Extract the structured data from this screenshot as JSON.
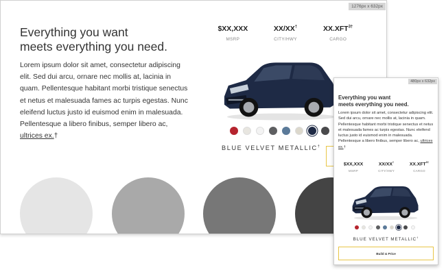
{
  "desktop": {
    "dim_badge": "1276px x 632px",
    "headline_line1": "Everything you want",
    "headline_line2": "meets everything you need.",
    "body": "Lorem ipsum dolor sit amet, consectetur adipiscing elit. Sed dui arcu, ornare nec mollis at, lacinia in quam. Pellentesque habitant morbi tristique senectus et netus et malesuada fames ac turpis egestas. Nunc eleifend luctus justo id euismod enim in malesuada. Pellentesque a libero finibus, semper libero ac, ",
    "body_link": "ultrices ex.",
    "body_mark": "†",
    "specs": [
      {
        "value": "$XX,XXX",
        "sup": "",
        "label": "MSRP"
      },
      {
        "value": "XX/XX",
        "sup": "†",
        "label": "CITY/HWY"
      },
      {
        "value": "XX.XFT",
        "sup": "3†",
        "label": "CARGO"
      }
    ],
    "color_name": "BLUE VELVET METALLIC",
    "color_mark": "†"
  },
  "mobile": {
    "dim_badge": "480px x 632px",
    "headline_line1": "Everything you want",
    "headline_line2": "meets everything you need.",
    "body": "Lorem ipsum dolor sit amet, consectetur adipiscing elit. Sed dui arcu, ornare nec mollis at, lacinia in quam. Pellentesque habitant morbi tristique senectus et netus et malesuada fames ac turpis egestas. Nunc eleifend luctus justo id euismod enim in malesuada. Pellentesque a libero finibus, semper libero ac, ",
    "body_link": "ultrices ex.",
    "body_mark": "†",
    "specs": [
      {
        "value": "$XX,XXX",
        "sup": "",
        "label": "MSRP"
      },
      {
        "value": "XX/XX",
        "sup": "†",
        "label": "CITY/HWY"
      },
      {
        "value": "XX.XFT",
        "sup": "3†",
        "label": "CARGO"
      }
    ],
    "color_name": "BLUE VELVET METALLIC",
    "color_mark": "†",
    "cta_label": "Build & Price"
  },
  "swatch_colors": [
    "#b5242e",
    "#e8e6e0",
    "#f3f3f3",
    "#5e5f61",
    "#5b7a99",
    "#dcd8cc",
    "#1e2a45",
    "#4a4a4c",
    "#f6f6f6"
  ],
  "selected_swatch": 6,
  "colors": {
    "accent_border": "#e8c545",
    "car_body": "#1e2a45",
    "circle_1": "#e5e5e5",
    "circle_2": "#a9a9a9",
    "circle_3": "#777777",
    "circle_4": "#444444"
  }
}
